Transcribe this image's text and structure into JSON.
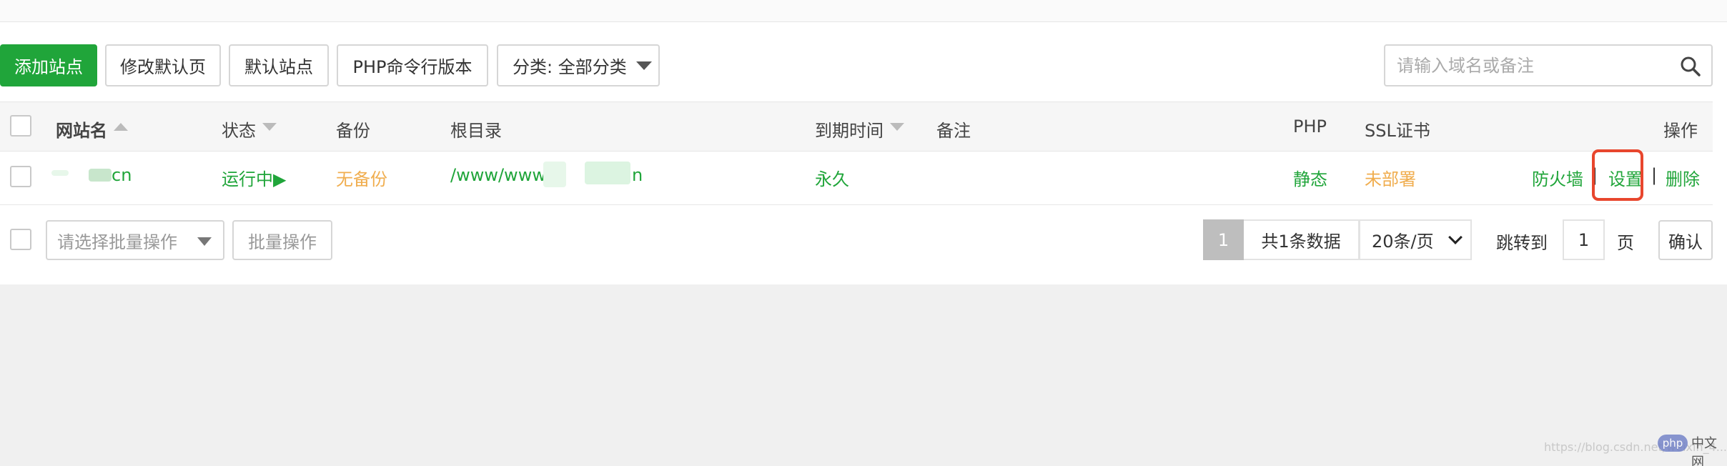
{
  "toolbar": {
    "add_site": "添加站点",
    "edit_default_page": "修改默认页",
    "default_site": "默认站点",
    "php_cli_version": "PHP命令行版本",
    "category_select": "分类: 全部分类",
    "search_placeholder": "请输入域名或备注"
  },
  "table": {
    "headers": {
      "site_name": "网站名",
      "status": "状态",
      "backup": "备份",
      "root_dir": "根目录",
      "expire": "到期时间",
      "note": "备注",
      "php": "PHP",
      "ssl": "SSL证书",
      "actions": "操作"
    },
    "rows": [
      {
        "site_name_visible": "cn",
        "status": "运行中▶",
        "backup": "无备份",
        "root_dir_visible": "/www/wwwr",
        "root_dir_tail": "n",
        "expire": "永久",
        "php": "静态",
        "ssl": "未部署",
        "action_firewall": "防火墙",
        "action_settings": "设置",
        "action_delete": "删除",
        "separator": "|"
      }
    ]
  },
  "footer": {
    "batch_select_placeholder": "请选择批量操作",
    "batch_button": "批量操作",
    "current_page": "1",
    "total_text": "共1条数据",
    "per_page": "20条/页",
    "jump_label": "跳转到",
    "jump_value": "1",
    "page_unit": "页",
    "confirm": "确认"
  },
  "watermark": {
    "url": "https://blog.csdn.net/weixin_4.......128",
    "badge": "php",
    "site": "中文网"
  },
  "colors": {
    "accent_green": "#20a53a",
    "warning_orange": "#f0ad4e",
    "highlight_red": "#e8462d"
  }
}
